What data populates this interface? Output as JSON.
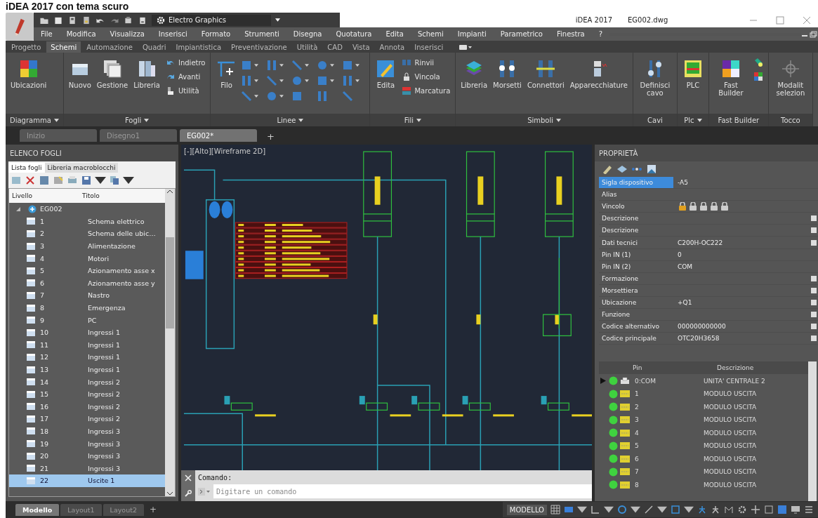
{
  "caption": "iDEA 2017 con tema scuro",
  "quick_access": {
    "workspace": "Electro Graphics"
  },
  "title_bar": {
    "app": "iDEA 2017",
    "file": "EG002.dwg"
  },
  "menu": [
    "File",
    "Modifica",
    "Visualizza",
    "Inserisci",
    "Formato",
    "Strumenti",
    "Disegna",
    "Quotatura",
    "Edita",
    "Schemi",
    "Impianti",
    "Parametrico",
    "Finestra",
    "?"
  ],
  "ribbon_tabs": [
    {
      "label": "Progetto",
      "selected": false
    },
    {
      "label": "Schemi",
      "selected": true
    },
    {
      "label": "Automazione",
      "selected": false
    },
    {
      "label": "Quadri",
      "selected": false
    },
    {
      "label": "Impiantistica",
      "selected": false
    },
    {
      "label": "Preventivazione",
      "selected": false
    },
    {
      "label": "Utilità",
      "selected": false
    },
    {
      "label": "CAD",
      "selected": false
    },
    {
      "label": "Vista",
      "selected": false
    },
    {
      "label": "Annota",
      "selected": false
    },
    {
      "label": "Inserisci",
      "selected": false
    }
  ],
  "ribbon_panels": [
    {
      "label": "Diagramma",
      "has_menu": true,
      "tools": [
        {
          "label": "Ubicazioni",
          "kind": "large"
        }
      ]
    },
    {
      "label": "Fogli",
      "has_menu": true,
      "tools": [
        {
          "label": "Nuovo",
          "kind": "large"
        },
        {
          "label": "Gestione",
          "kind": "large"
        },
        {
          "label": "Libreria",
          "kind": "large"
        },
        {
          "label": "Indietro",
          "kind": "small"
        },
        {
          "label": "Avanti",
          "kind": "small"
        },
        {
          "label": "Utilità",
          "kind": "small"
        }
      ]
    },
    {
      "label": "Linee",
      "has_menu": true,
      "tools": [
        {
          "label": "Filo",
          "kind": "large"
        },
        {
          "kind": "icon_grid"
        }
      ]
    },
    {
      "label": "Fili",
      "has_menu": true,
      "tools": [
        {
          "label": "Edita",
          "kind": "large"
        },
        {
          "label": "Rinvii",
          "kind": "small"
        },
        {
          "label": "Vincola",
          "kind": "small"
        },
        {
          "label": "Marcatura",
          "kind": "small"
        }
      ]
    },
    {
      "label": "Simboli",
      "has_menu": true,
      "tools": [
        {
          "label": "Libreria",
          "kind": "large"
        },
        {
          "label": "Morsetti",
          "kind": "large"
        },
        {
          "label": "Connettori",
          "kind": "large"
        },
        {
          "label": "Apparecchiature",
          "kind": "large"
        }
      ]
    },
    {
      "label": "Cavi",
      "has_menu": false,
      "tools": [
        {
          "label": "Definisci cavo",
          "kind": "large"
        }
      ]
    },
    {
      "label": "Plc",
      "has_menu": true,
      "tools": [
        {
          "label": "PLC",
          "kind": "large"
        }
      ]
    },
    {
      "label": "Fast Builder",
      "has_menu": false,
      "tools": [
        {
          "label": "Fast Builder",
          "kind": "large"
        },
        {
          "kind": "icon_stack"
        }
      ]
    },
    {
      "label": "Tocco",
      "has_menu": false,
      "tools": [
        {
          "label": "Modalit selezion",
          "kind": "large"
        }
      ]
    }
  ],
  "doc_tabs": [
    {
      "label": "Inizio",
      "selected": false
    },
    {
      "label": "Disegno1",
      "selected": false
    },
    {
      "label": "EG002*",
      "selected": true
    }
  ],
  "new_tab": "+",
  "sheet_panel": {
    "title": "ELENCO FOGLI",
    "tabs": [
      {
        "label": "Lista fogli",
        "selected": true
      },
      {
        "label": "Libreria macroblocchi",
        "selected": false
      }
    ],
    "columns": [
      "Livello",
      "Titolo"
    ],
    "tree": [
      {
        "label": "EG002",
        "expanded": true,
        "children": [
          {
            "number": "1",
            "title": "Schema elettrico",
            "selected": false
          },
          {
            "number": "2",
            "title": "Schema delle ubic…",
            "selected": false
          },
          {
            "number": "3",
            "title": "Alimentazione",
            "selected": false
          },
          {
            "number": "4",
            "title": "Motori",
            "selected": false
          },
          {
            "number": "5",
            "title": "Azionamento asse x",
            "selected": false
          },
          {
            "number": "6",
            "title": "Azionamento asse y",
            "selected": false
          },
          {
            "number": "7",
            "title": "Nastro",
            "selected": false
          },
          {
            "number": "8",
            "title": "Emergenza",
            "selected": false
          },
          {
            "number": "9",
            "title": "PC",
            "selected": false
          },
          {
            "number": "10",
            "title": "Ingressi 1",
            "selected": false
          },
          {
            "number": "11",
            "title": "Ingressi 1",
            "selected": false
          },
          {
            "number": "12",
            "title": "Ingressi 1",
            "selected": false
          },
          {
            "number": "13",
            "title": "Ingressi 1",
            "selected": false
          },
          {
            "number": "14",
            "title": "Ingressi 2",
            "selected": false
          },
          {
            "number": "15",
            "title": "Ingressi 2",
            "selected": false
          },
          {
            "number": "16",
            "title": "Ingressi 2",
            "selected": false
          },
          {
            "number": "17",
            "title": "Ingressi 2",
            "selected": false
          },
          {
            "number": "18",
            "title": "Ingressi 3",
            "selected": false
          },
          {
            "number": "19",
            "title": "Ingressi 3",
            "selected": false
          },
          {
            "number": "20",
            "title": "Ingressi 3",
            "selected": false
          },
          {
            "number": "21",
            "title": "Ingressi 3",
            "selected": false
          },
          {
            "number": "22",
            "title": "Uscite 1",
            "selected": true
          }
        ]
      }
    ]
  },
  "viewport": {
    "label": "[-][Alto][Wireframe 2D]"
  },
  "command": {
    "history": "Comando:",
    "placeholder": "Digitare un comando"
  },
  "properties": {
    "title": "PROPRIETÀ",
    "rows": [
      {
        "label": "Sigla dispositivo",
        "value": "-A5",
        "kind": "text",
        "selected": true,
        "has_button": false
      },
      {
        "label": "Alias",
        "kind": "text",
        "selected": false,
        "has_button": false
      },
      {
        "label": "Vincolo",
        "kind": "locks",
        "selected": false,
        "has_button": false
      },
      {
        "label": "Descrizione",
        "kind": "text",
        "selected": false,
        "has_button": true
      },
      {
        "label": "Descrizione",
        "kind": "text",
        "selected": false,
        "has_button": true
      },
      {
        "label": "Dati tecnici",
        "value": "C200H-OC222",
        "kind": "text",
        "selected": false,
        "has_button": true
      },
      {
        "label": "Pin IN  (1)",
        "value": "0",
        "kind": "text",
        "selected": false,
        "has_button": false
      },
      {
        "label": "Pin IN  (2)",
        "value": "COM",
        "kind": "text",
        "selected": false,
        "has_button": false
      },
      {
        "label": "Formazione",
        "kind": "text",
        "selected": false,
        "has_button": true
      },
      {
        "label": "Morsettiera",
        "kind": "text",
        "selected": false,
        "has_button": true
      },
      {
        "label": "Ubicazione",
        "value": "+Q1",
        "kind": "text",
        "selected": false,
        "has_button": true
      },
      {
        "label": "Funzione",
        "kind": "text",
        "selected": false,
        "has_button": true
      },
      {
        "label": "Codice alternativo",
        "value": "000000000000",
        "kind": "text",
        "selected": false,
        "has_button": true
      },
      {
        "label": "Codice principale",
        "value": "OTC20H3658",
        "kind": "text",
        "selected": false,
        "has_button": true
      }
    ]
  },
  "pins": {
    "columns": [
      "Pin",
      "Descrizione"
    ],
    "rows": [
      {
        "pin": "0:COM",
        "description": "UNITA' CENTRALE 2",
        "kind": "common",
        "selected": true
      },
      {
        "pin": "1",
        "description": "MODULO USCITA",
        "kind": "output",
        "selected": false
      },
      {
        "pin": "2",
        "description": "MODULO USCITA",
        "kind": "output",
        "selected": false
      },
      {
        "pin": "3",
        "description": "MODULO USCITA",
        "kind": "output",
        "selected": false
      },
      {
        "pin": "4",
        "description": "MODULO USCITA",
        "kind": "output",
        "selected": false
      },
      {
        "pin": "5",
        "description": "MODULO USCITA",
        "kind": "output",
        "selected": false
      },
      {
        "pin": "6",
        "description": "MODULO USCITA",
        "kind": "output",
        "selected": false
      },
      {
        "pin": "7",
        "description": "MODULO USCITA",
        "kind": "output",
        "selected": false
      },
      {
        "pin": "8",
        "description": "MODULO USCITA",
        "kind": "output",
        "selected": false
      }
    ]
  },
  "layout_tabs": [
    {
      "label": "Modello",
      "selected": true
    },
    {
      "label": "Layout1",
      "selected": false
    },
    {
      "label": "Layout2",
      "selected": false
    }
  ],
  "add_layout": "+",
  "space": "MODELLO"
}
